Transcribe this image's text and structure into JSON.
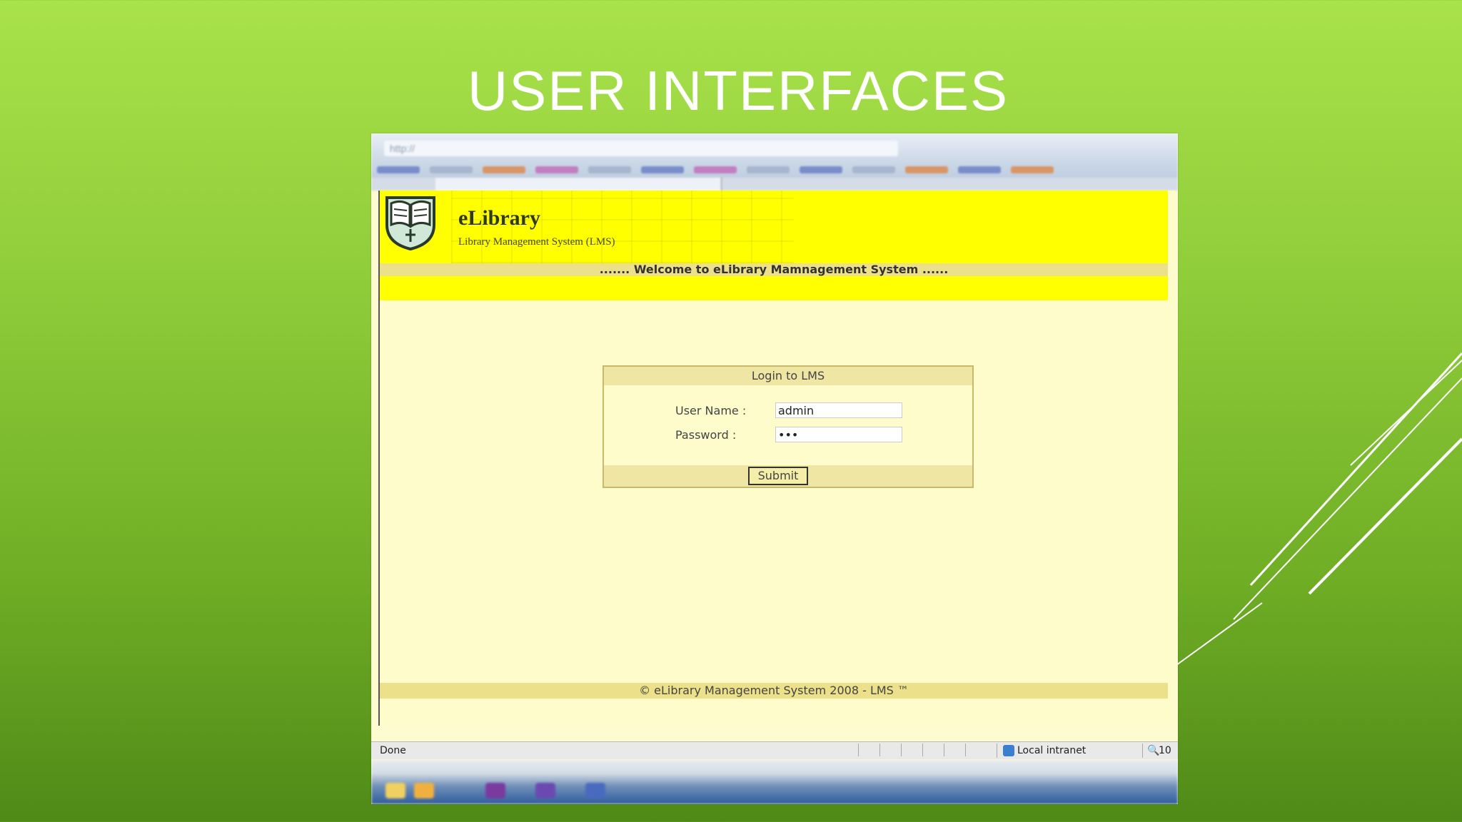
{
  "slide": {
    "title": "USER INTERFACES"
  },
  "browser": {
    "address": "http://",
    "status_text": "Done",
    "zone_label": "Local intranet",
    "zoom_label": "10"
  },
  "header": {
    "brand": "eLibrary",
    "tagline": "Library Management System (LMS)",
    "welcome": "....... Welcome to eLibrary Mamnagement System ......"
  },
  "login": {
    "heading": "Login to LMS",
    "username_label": "User Name :",
    "username_value": "admin",
    "password_label": "Password :",
    "password_value": "•••",
    "submit_label": "Submit"
  },
  "footer": {
    "copyright": "© eLibrary Management System 2008 - LMS ™"
  },
  "colors": {
    "header_yellow": "#ffff00",
    "page_bg": "#fffccc",
    "bar_tan": "#ece08a"
  }
}
